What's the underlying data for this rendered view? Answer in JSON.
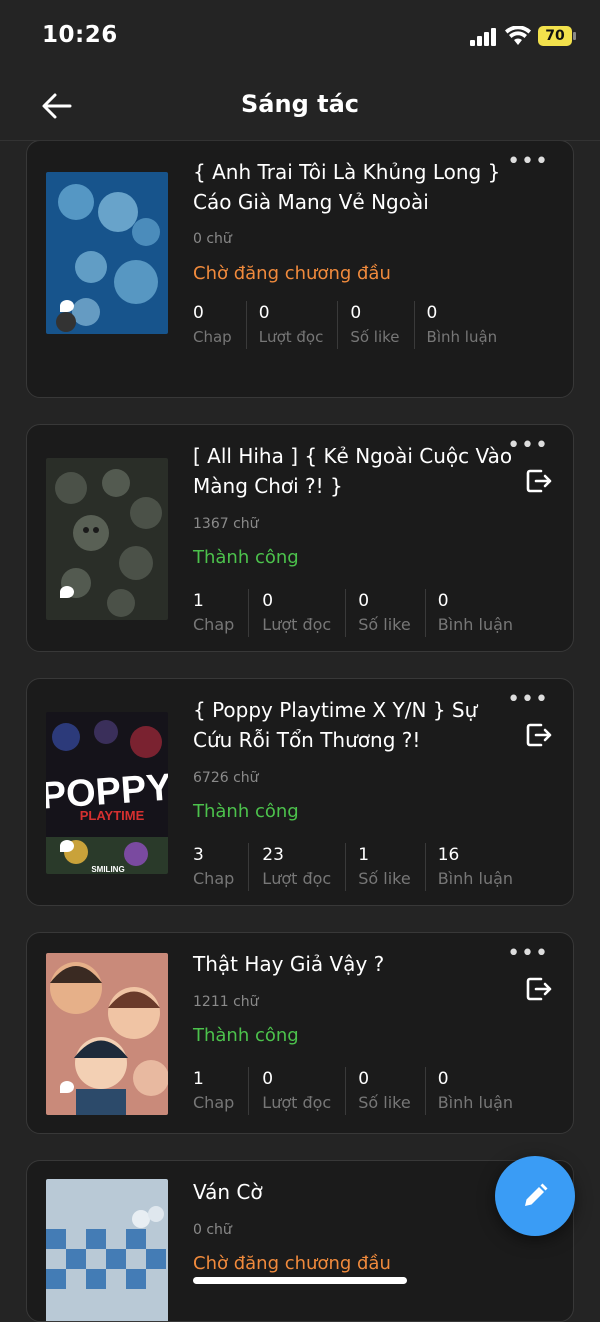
{
  "status_bar": {
    "time": "10:26",
    "battery": "70"
  },
  "header": {
    "title": "Sáng tác"
  },
  "stat_labels": {
    "chap": "Chap",
    "reads": "Lượt đọc",
    "likes": "Số like",
    "comments": "Bình luận"
  },
  "stories": [
    {
      "title": "{ Anh Trai Tôi Là Khủng Long } Cáo Già Mang Vẻ Ngoài",
      "words": "0 chữ",
      "status": "Chờ đăng chương đầu",
      "status_color": "#f08a3c",
      "chap": "0",
      "reads": "0",
      "likes": "0",
      "comments": "0"
    },
    {
      "title": "[ All Hiha ] { Kẻ Ngoài Cuộc Vào Màng Chơi ?! }",
      "words": "1367 chữ",
      "status": "Thành công",
      "status_color": "#4cc24c",
      "chap": "1",
      "reads": "0",
      "likes": "0",
      "comments": "0"
    },
    {
      "title": "{ Poppy Playtime X Y/N } Sự Cứu Rỗi Tổn Thương ?!",
      "words": "6726 chữ",
      "status": "Thành công",
      "status_color": "#4cc24c",
      "chap": "3",
      "reads": "23",
      "likes": "1",
      "comments": "16",
      "cover_text": "POPPY",
      "cover_subtext": "PLAYTIME",
      "cover_subtext2": "SMILING"
    },
    {
      "title": "Thật Hay Giả Vậy ?",
      "words": "1211 chữ",
      "status": "Thành công",
      "status_color": "#4cc24c",
      "chap": "1",
      "reads": "0",
      "likes": "0",
      "comments": "0"
    },
    {
      "title": "Ván Cờ",
      "words": "0 chữ",
      "status": "Chờ đăng chương đầu",
      "status_color": "#f08a3c"
    }
  ],
  "colors": {
    "background": "#242424",
    "card": "#1b1b1b",
    "accent": "#3a9cf5",
    "pending": "#f08a3c",
    "success": "#4cc24c"
  },
  "icons": {
    "back": "arrow-left-icon",
    "more": "more-dots-icon",
    "exit": "exit-door-icon",
    "fab": "pencil-icon"
  }
}
